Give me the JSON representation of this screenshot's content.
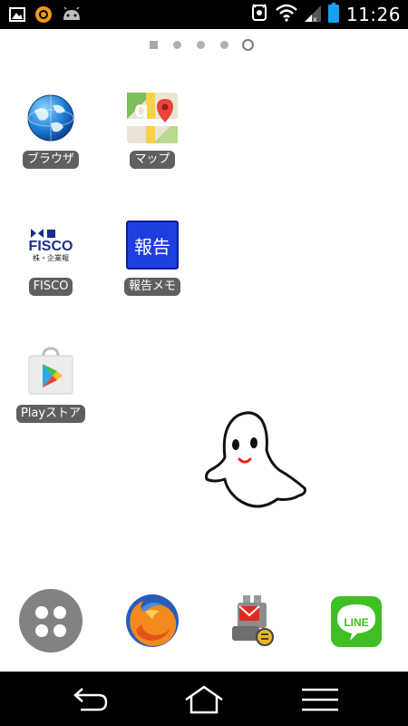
{
  "status_bar": {
    "time": "11:26",
    "left_icons": [
      "picture-notification-icon",
      "orange-ring-notification-icon",
      "android-notification-icon"
    ],
    "right_icons": [
      "alarm-notification-icon",
      "wifi-icon",
      "signal-icon",
      "battery-icon"
    ]
  },
  "page_indicator": {
    "pages": 5,
    "current": 5
  },
  "apps": [
    {
      "label": "ブラウザ",
      "icon": "globe-icon"
    },
    {
      "label": "マップ",
      "icon": "maps-icon"
    },
    {
      "label": "FISCO",
      "icon": "fisco-icon",
      "logo_text": "FISCO",
      "logo_subtext": "株・企業報"
    },
    {
      "label": "報告メモ",
      "icon": "memo-icon",
      "icon_text": "報告"
    },
    {
      "label": "Playストア",
      "icon": "play-store-icon"
    }
  ],
  "dock": [
    {
      "name": "app-drawer",
      "icon": "app-drawer-icon"
    },
    {
      "name": "firefox",
      "icon": "firefox-icon"
    },
    {
      "name": "mail-robot",
      "icon": "mail-robot-icon"
    },
    {
      "name": "line",
      "icon": "line-icon",
      "icon_text": "LINE"
    }
  ],
  "nav": [
    "back-icon",
    "home-icon",
    "menu-icon"
  ],
  "colors": {
    "status_bar": "#000000",
    "nav_bar": "#000000",
    "label_bg": "#5f5f5f",
    "line_green": "#3fbf22",
    "houkoku_blue": "#1f3ee0"
  }
}
